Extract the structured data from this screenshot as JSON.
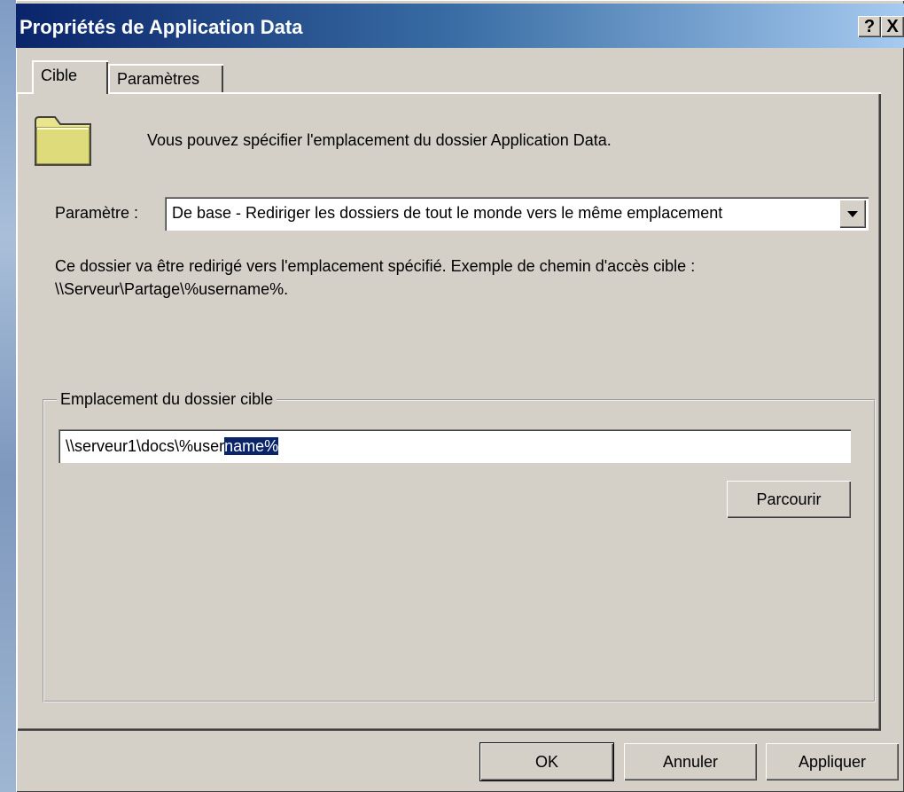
{
  "window": {
    "title": "Propriétés de Application Data"
  },
  "titlebar_buttons": {
    "help": "?",
    "close": "X"
  },
  "tabs": [
    {
      "label": "Cible"
    },
    {
      "label": "Paramètres"
    }
  ],
  "header": {
    "description": "Vous pouvez spécifier l'emplacement du dossier Application Data."
  },
  "setting": {
    "label": "Paramètre :",
    "selected": "De base - Rediriger les dossiers de tout le monde vers le même emplacement"
  },
  "info": {
    "line1": "Ce dossier va être redirigé vers l'emplacement spécifié. Exemple de chemin d'accès cible :",
    "line2": "\\\\Serveur\\Partage\\%username%."
  },
  "target": {
    "group_label": "Emplacement du dossier cible",
    "path_unselected": "\\\\serveur1\\docs\\%user",
    "path_selected": "name%",
    "browse": "Parcourir"
  },
  "footer": {
    "ok": "OK",
    "cancel": "Annuler",
    "apply": "Appliquer"
  },
  "colors": {
    "titlebar_start": "#0a246a",
    "titlebar_end": "#a6caf0",
    "face": "#d4d0c8",
    "selection": "#0a246a"
  }
}
